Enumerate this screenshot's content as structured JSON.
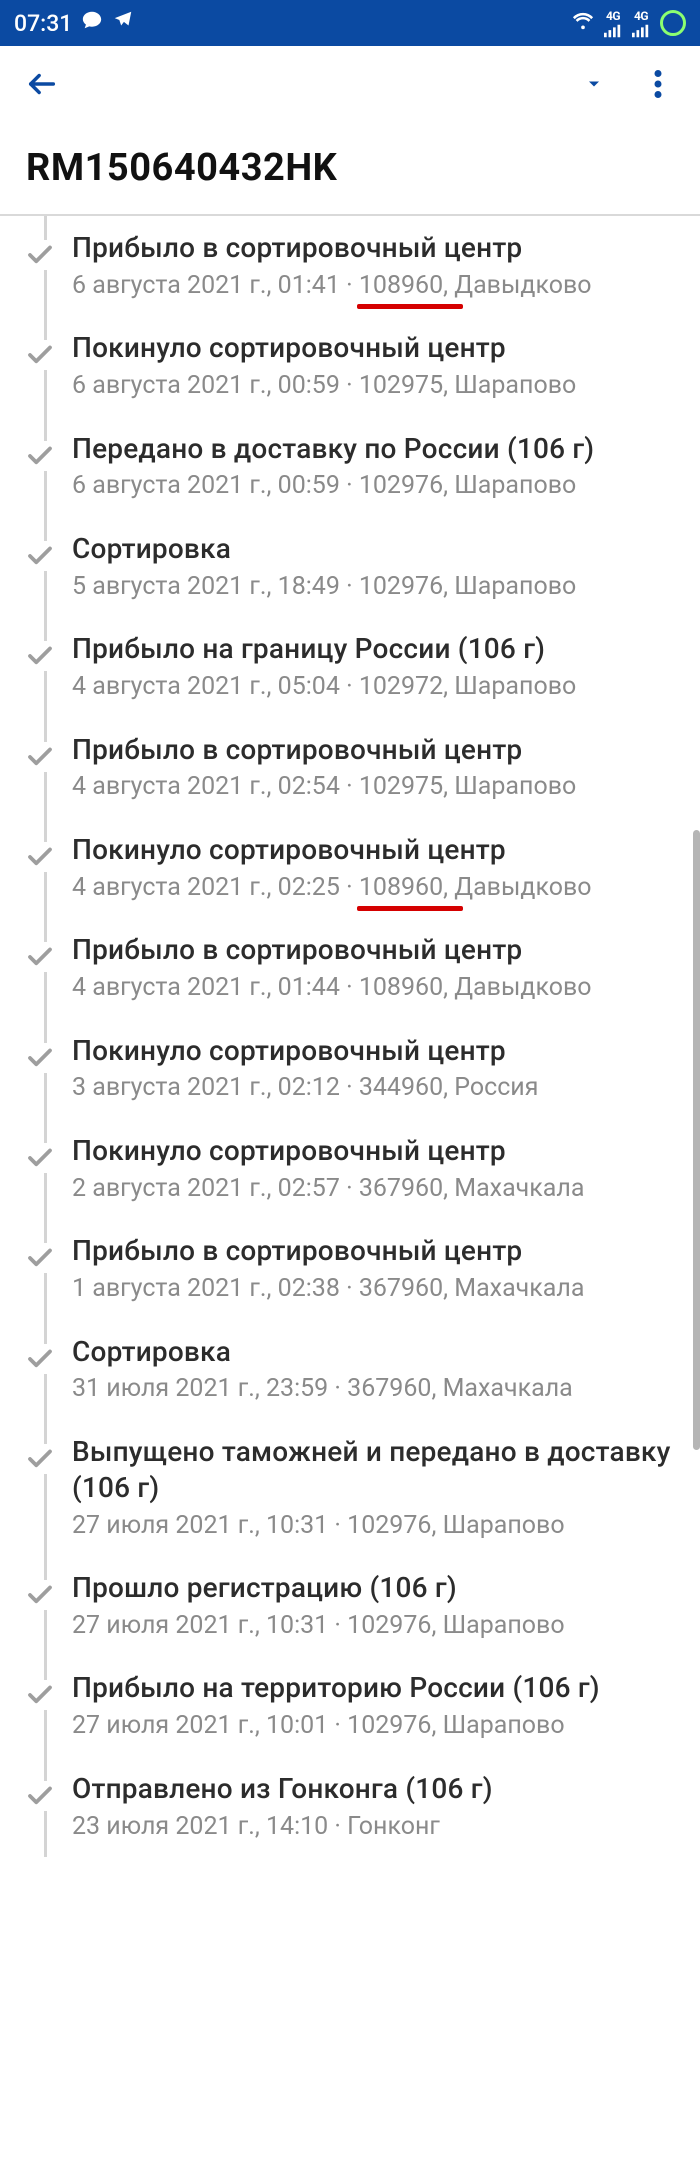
{
  "status": {
    "time": "07:31",
    "sig1": "4G",
    "sig2": "4G"
  },
  "title": "RM150640432HK",
  "events": [
    {
      "title": "Прибыло в сортировочный центр",
      "meta_before": "6 августа 2021 г., 01:41 · ",
      "meta_hl": "108960",
      "meta_after": ", Давыдково",
      "hl": true
    },
    {
      "title": "Покинуло сортировочный центр",
      "meta_before": "6 августа 2021 г., 00:59 · 102975, Шарапово",
      "meta_hl": "",
      "meta_after": "",
      "hl": false
    },
    {
      "title": "Передано в доставку по России (106 г)",
      "meta_before": "6 августа 2021 г., 00:59 · 102976, Шарапово",
      "meta_hl": "",
      "meta_after": "",
      "hl": false
    },
    {
      "title": "Сортировка",
      "meta_before": "5 августа 2021 г., 18:49 · 102976, Шарапово",
      "meta_hl": "",
      "meta_after": "",
      "hl": false
    },
    {
      "title": "Прибыло на границу России (106 г)",
      "meta_before": "4 августа 2021 г., 05:04 · 102972, Шарапово",
      "meta_hl": "",
      "meta_after": "",
      "hl": false
    },
    {
      "title": "Прибыло в сортировочный центр",
      "meta_before": "4 августа 2021 г., 02:54 · 102975, Шарапово",
      "meta_hl": "",
      "meta_after": "",
      "hl": false
    },
    {
      "title": "Покинуло сортировочный центр",
      "meta_before": "4 августа 2021 г., 02:25 · ",
      "meta_hl": "108960",
      "meta_after": ", Давыдково",
      "hl": true
    },
    {
      "title": "Прибыло в сортировочный центр",
      "meta_before": "4 августа 2021 г., 01:44 · 108960, Давыдково",
      "meta_hl": "",
      "meta_after": "",
      "hl": false
    },
    {
      "title": "Покинуло сортировочный центр",
      "meta_before": "3 августа 2021 г., 02:12 · 344960, Россия",
      "meta_hl": "",
      "meta_after": "",
      "hl": false
    },
    {
      "title": "Покинуло сортировочный центр",
      "meta_before": "2 августа 2021 г., 02:57 · 367960, Махачкала",
      "meta_hl": "",
      "meta_after": "",
      "hl": false
    },
    {
      "title": "Прибыло в сортировочный центр",
      "meta_before": "1 августа 2021 г., 02:38 · 367960, Махачкала",
      "meta_hl": "",
      "meta_after": "",
      "hl": false
    },
    {
      "title": "Сортировка",
      "meta_before": "31 июля 2021 г., 23:59 · 367960, Махачкала",
      "meta_hl": "",
      "meta_after": "",
      "hl": false
    },
    {
      "title": "Выпущено таможней и передано в доставку (106 г)",
      "meta_before": "27 июля 2021 г., 10:31 · 102976, Шарапово",
      "meta_hl": "",
      "meta_after": "",
      "hl": false
    },
    {
      "title": "Прошло регистрацию (106 г)",
      "meta_before": "27 июля 2021 г., 10:31 · 102976, Шарапово",
      "meta_hl": "",
      "meta_after": "",
      "hl": false
    },
    {
      "title": "Прибыло на территорию России (106 г)",
      "meta_before": "27 июля 2021 г., 10:01 · 102976, Шарапово",
      "meta_hl": "",
      "meta_after": "",
      "hl": false
    },
    {
      "title": "Отправлено из Гонконга (106 г)",
      "meta_before": "23 июля 2021 г., 14:10 · Гонконг",
      "meta_hl": "",
      "meta_after": "",
      "hl": false
    }
  ]
}
